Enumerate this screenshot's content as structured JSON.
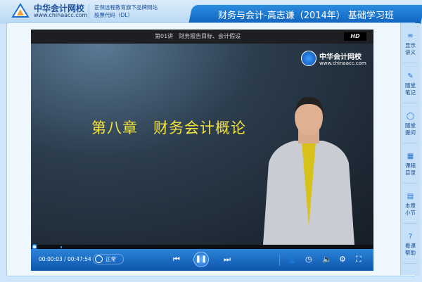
{
  "header": {
    "logo_cn": "中华会计网校",
    "logo_url": "www.chinaacc.com",
    "slogan1": "正保远程教育旗下品牌网站",
    "slogan2": "股票代码（DL）",
    "course_title": "财务与会计-高志谦（2014年） 基础学习班"
  },
  "video": {
    "lecture_title": "第01讲　财务报告目标、会计假设",
    "hd_label": "HD",
    "watermark_cn": "中华会计网校",
    "watermark_url": "www.chinaacc.com",
    "slide_text": "第八章　财务会计概论",
    "progress_fraction": 0.001
  },
  "controls": {
    "current_time": "00:00:03",
    "separator": "/",
    "duration": "00:47:54",
    "speed": "正常"
  },
  "sidebar": {
    "items": [
      {
        "label1": "显示",
        "label2": "讲义",
        "icon": "≡"
      },
      {
        "label1": "随堂",
        "label2": "笔记",
        "icon": "✎"
      },
      {
        "label1": "随堂",
        "label2": "提问",
        "icon": "◯"
      },
      {
        "label1": "课程",
        "label2": "目录",
        "icon": "▦"
      },
      {
        "label1": "本章",
        "label2": "小节",
        "icon": "▤"
      },
      {
        "label1": "看课",
        "label2": "帮助",
        "icon": "?"
      }
    ]
  }
}
